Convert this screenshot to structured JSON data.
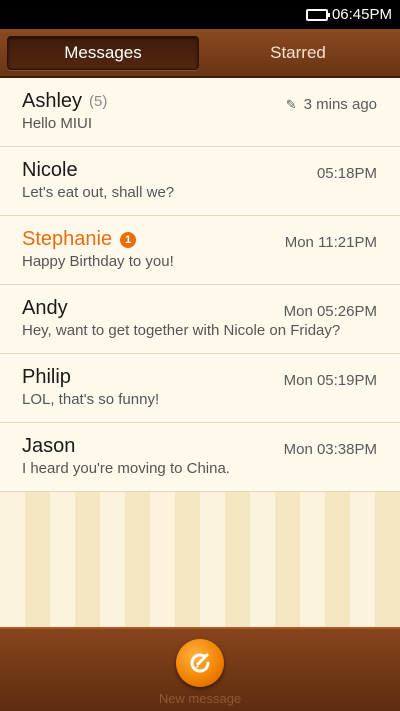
{
  "status_bar": {
    "time": "06:45PM",
    "battery_icon": "battery-full-icon"
  },
  "tabs": [
    {
      "label": "Messages",
      "active": true
    },
    {
      "label": "Starred",
      "active": false
    }
  ],
  "conversations": [
    {
      "name": "Ashley",
      "count": "(5)",
      "time": "3 mins ago",
      "draft": true,
      "preview": "Hello MIUI",
      "unread": false
    },
    {
      "name": "Nicole",
      "time": "05:18PM",
      "preview": "Let's eat out, shall we?",
      "unread": false
    },
    {
      "name": "Stephanie",
      "badge": "1",
      "time": "Mon 11:21PM",
      "preview": "Happy Birthday to you!",
      "unread": true
    },
    {
      "name": "Andy",
      "time": "Mon 05:26PM",
      "preview": "Hey, want to get together with Nicole on Friday?",
      "unread": false
    },
    {
      "name": "Philip",
      "time": "Mon 05:19PM",
      "preview": "LOL, that's so funny!",
      "unread": false
    },
    {
      "name": "Jason",
      "time": "Mon 03:38PM",
      "preview": "I heard you're moving to China.",
      "unread": false
    }
  ],
  "footer": {
    "new_message_label": "New message",
    "icon": "compose-icon"
  },
  "colors": {
    "accent": "#ea6d0c",
    "header": "#7a3c18",
    "list_bg": "#fff9ec"
  }
}
